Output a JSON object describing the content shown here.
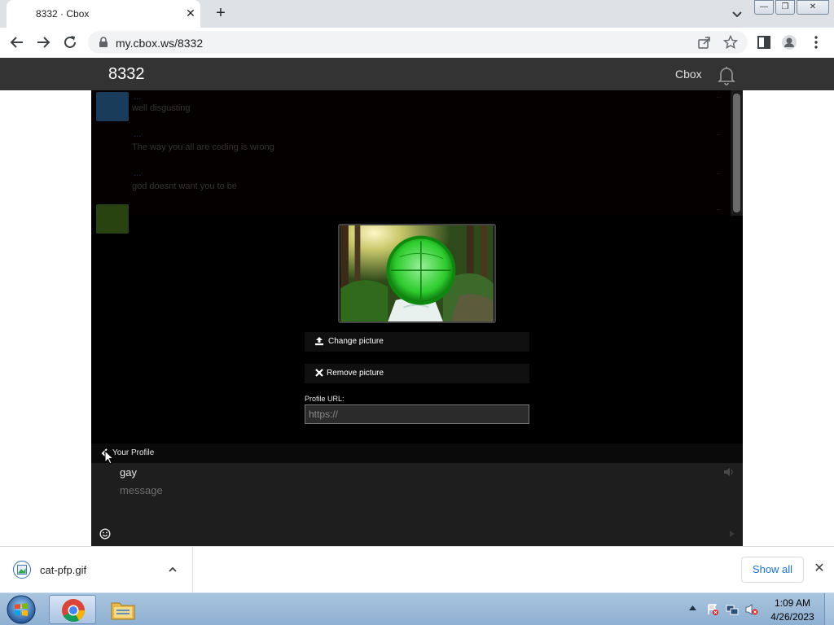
{
  "browser": {
    "tab_title": "8332 · Cbox",
    "tab_close": "✕",
    "new_tab": "+",
    "url": "my.cbox.ws/8332",
    "window_buttons": [
      "—",
      "❐",
      "✕"
    ]
  },
  "site": {
    "title": "8332",
    "brand_link": "Cbox"
  },
  "chat": {
    "messages": [
      {
        "name": "...",
        "text": "well disgusting",
        "time": "...",
        "avatar_color": "#2c6ea5"
      },
      {
        "name": "...",
        "text": "The way you all are coding is wrong",
        "time": "...",
        "avatar_color": "#120000"
      },
      {
        "name": "...",
        "text": "god doesnt want you to be",
        "time": "...",
        "avatar_color": "#120000"
      },
      {
        "name": "",
        "text": "",
        "time": "...",
        "avatar_color": "#4a7a1c"
      }
    ]
  },
  "profile": {
    "change_picture": "Change picture",
    "remove_picture": "Remove picture",
    "url_label": "Profile URL:",
    "url_placeholder": "https://",
    "panel_title": "Your Profile"
  },
  "composer": {
    "name_value": "gay",
    "message_placeholder": "message"
  },
  "downloads": {
    "file_name": "cat-pfp.gif",
    "show_all": "Show all",
    "close": "✕"
  },
  "taskbar": {
    "time": "1:09 AM",
    "date": "4/26/2023"
  },
  "colors": {
    "site_bar": "#333333",
    "chat_bg": "#000000",
    "accent_green": "#1fcc1f",
    "link_blue": "#1a73e8"
  }
}
